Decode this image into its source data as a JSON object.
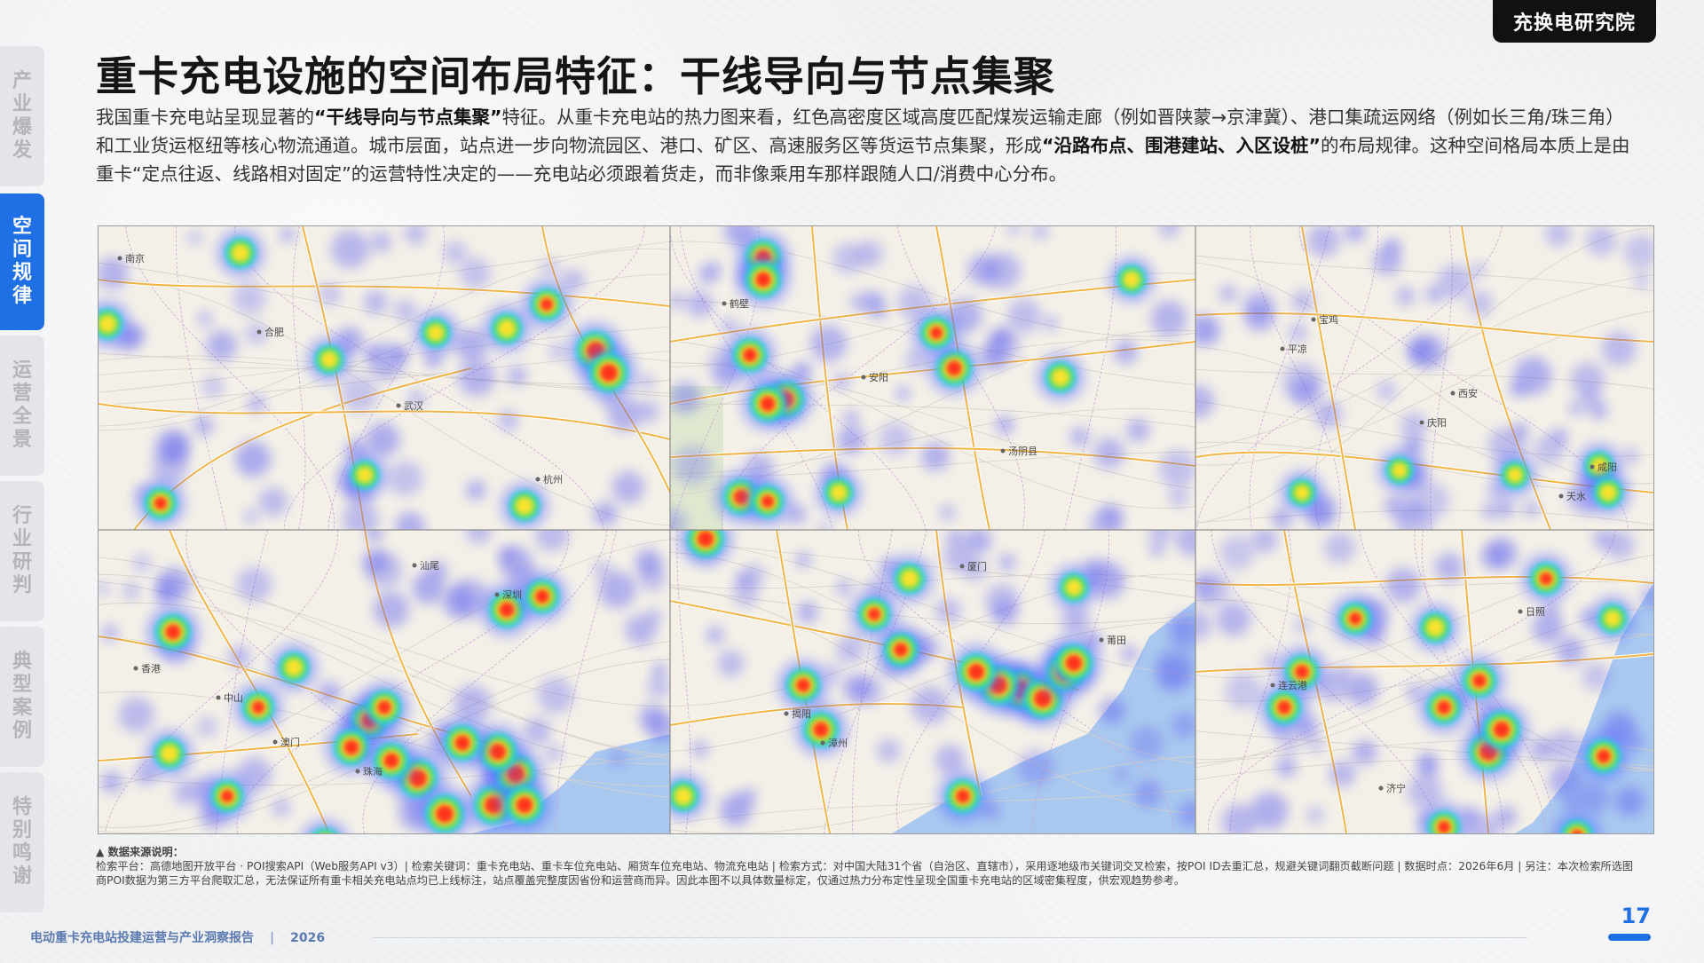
{
  "brand": "充换电研究院",
  "nav": [
    {
      "label": "产业爆发",
      "active": false
    },
    {
      "label": "空间规律",
      "active": true
    },
    {
      "label": "运营全景",
      "active": false
    },
    {
      "label": "行业研判",
      "active": false
    },
    {
      "label": "典型案例",
      "active": false
    },
    {
      "label": "特别鸣谢",
      "active": false
    }
  ],
  "title": "重卡充电设施的空间布局特征：干线导向与节点集聚",
  "intro": {
    "p1": "我国重卡充电站呈现显著的",
    "b1": "“干线导向与节点集聚”",
    "p2": "特征。从重卡充电站的热力图来看，红色高密度区域高度匹配煤炭运输走廊（例如晋陕蒙→京津冀）、港口集疏运网络（例如长三角/珠三角）和工业货运枢纽等核心物流通道。城市层面，站点进一步向物流园区、港口、矿区、高速服务区等货运节点集聚，形成",
    "b2": "“沿路布点、围港建站、入区设桩”",
    "p3": "的布局规律。这种空间格局本质上是由重卡“定点往返、线路相对固定”的运营特性决定的——充电站必须跟着货走，而非像乘用车那样跟随人口/消费中心分布。"
  },
  "maps": {
    "colors": {
      "land": "#f4f0e8",
      "sea": "#aac8ef",
      "road": "#f2b544",
      "border": "#c9a8d4",
      "hot": "#ff2a1a"
    },
    "panel_labels": [
      [
        "南京",
        "合肥",
        "武汉",
        "杭州"
      ],
      [
        "鹤壁",
        "安阳",
        "汤阴县"
      ],
      [
        "平凉",
        "庆阳",
        "天水",
        "宝鸡",
        "西安",
        "咸阳"
      ],
      [
        "中山",
        "珠海",
        "深圳",
        "香港",
        "澳门",
        "汕尾"
      ],
      [
        "漳州",
        "厦门",
        "莆田",
        "揭阳"
      ],
      [
        "济宁",
        "日照",
        "连云港"
      ]
    ]
  },
  "note": {
    "label": "▲ 数据来源说明：",
    "text": "检索平台：高德地图开放平台 · POI搜索API（Web服务API v3）| 检索关键词：重卡充电站、重卡车位充电站、厢货车位充电站、物流充电站 | 检索方式：对中国大陆31个省（自治区、直辖市），采用逐地级市关键词交叉检索，按POI ID去重汇总，规避关键词翻页截断问题 | 数据时点：2026年6月 | 另注：本次检索所选图商POI数据为第三方平台爬取汇总，无法保证所有重卡相关充电站点均已上线标注，站点覆盖完整度因省份和运营商而异。因此本图不以具体数量标定，仅通过热力分布定性呈现全国重卡充电站的区域密集程度，供宏观趋势参考。"
  },
  "footer": {
    "report": "电动重卡充电站投建运营与产业洞察报告",
    "year": "2026"
  },
  "page": "17"
}
